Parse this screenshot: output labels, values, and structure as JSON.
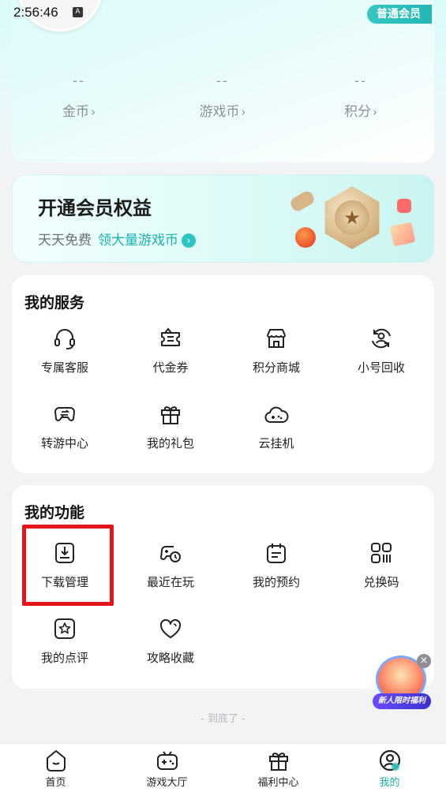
{
  "status_bar": {
    "time": "2:56:46",
    "indicator": "A"
  },
  "header": {
    "member_tag": "普通会员"
  },
  "wallet": {
    "items": [
      {
        "value": "--",
        "label": "金币"
      },
      {
        "value": "--",
        "label": "游戏币"
      },
      {
        "value": "--",
        "label": "积分"
      }
    ],
    "chevron": "›"
  },
  "vip_banner": {
    "title": "开通会员权益",
    "subtitle": "天天免费",
    "highlight": "领大量游戏币",
    "arrow": "›"
  },
  "services": {
    "title": "我的服务",
    "items": [
      {
        "label": "专属客服",
        "icon": "headset-icon"
      },
      {
        "label": "代金券",
        "icon": "coupon-icon"
      },
      {
        "label": "积分商城",
        "icon": "store-icon"
      },
      {
        "label": "小号回收",
        "icon": "recycle-account-icon"
      },
      {
        "label": "转游中心",
        "icon": "gamepad-transfer-icon"
      },
      {
        "label": "我的礼包",
        "icon": "gift-icon"
      },
      {
        "label": "云挂机",
        "icon": "cloud-gamepad-icon"
      }
    ]
  },
  "features": {
    "title": "我的功能",
    "items": [
      {
        "label": "下载管理",
        "icon": "download-icon"
      },
      {
        "label": "最近在玩",
        "icon": "recent-play-icon"
      },
      {
        "label": "我的预约",
        "icon": "calendar-icon"
      },
      {
        "label": "兑换码",
        "icon": "redeem-code-icon"
      },
      {
        "label": "我的点评",
        "icon": "review-star-icon"
      },
      {
        "label": "攻略收藏",
        "icon": "heart-icon"
      }
    ]
  },
  "footer_note": "- 到底了 -",
  "float_promo": {
    "label": "新人限时福利",
    "close": "×"
  },
  "tabbar": {
    "tabs": [
      {
        "label": "首页",
        "icon": "home-icon"
      },
      {
        "label": "游戏大厅",
        "icon": "game-hall-icon"
      },
      {
        "label": "福利中心",
        "icon": "welfare-gift-icon"
      },
      {
        "label": "我的",
        "icon": "profile-icon"
      }
    ],
    "active_index": 3
  },
  "colors": {
    "accent": "#1fb2af",
    "highlight_box": "#e4141b"
  }
}
